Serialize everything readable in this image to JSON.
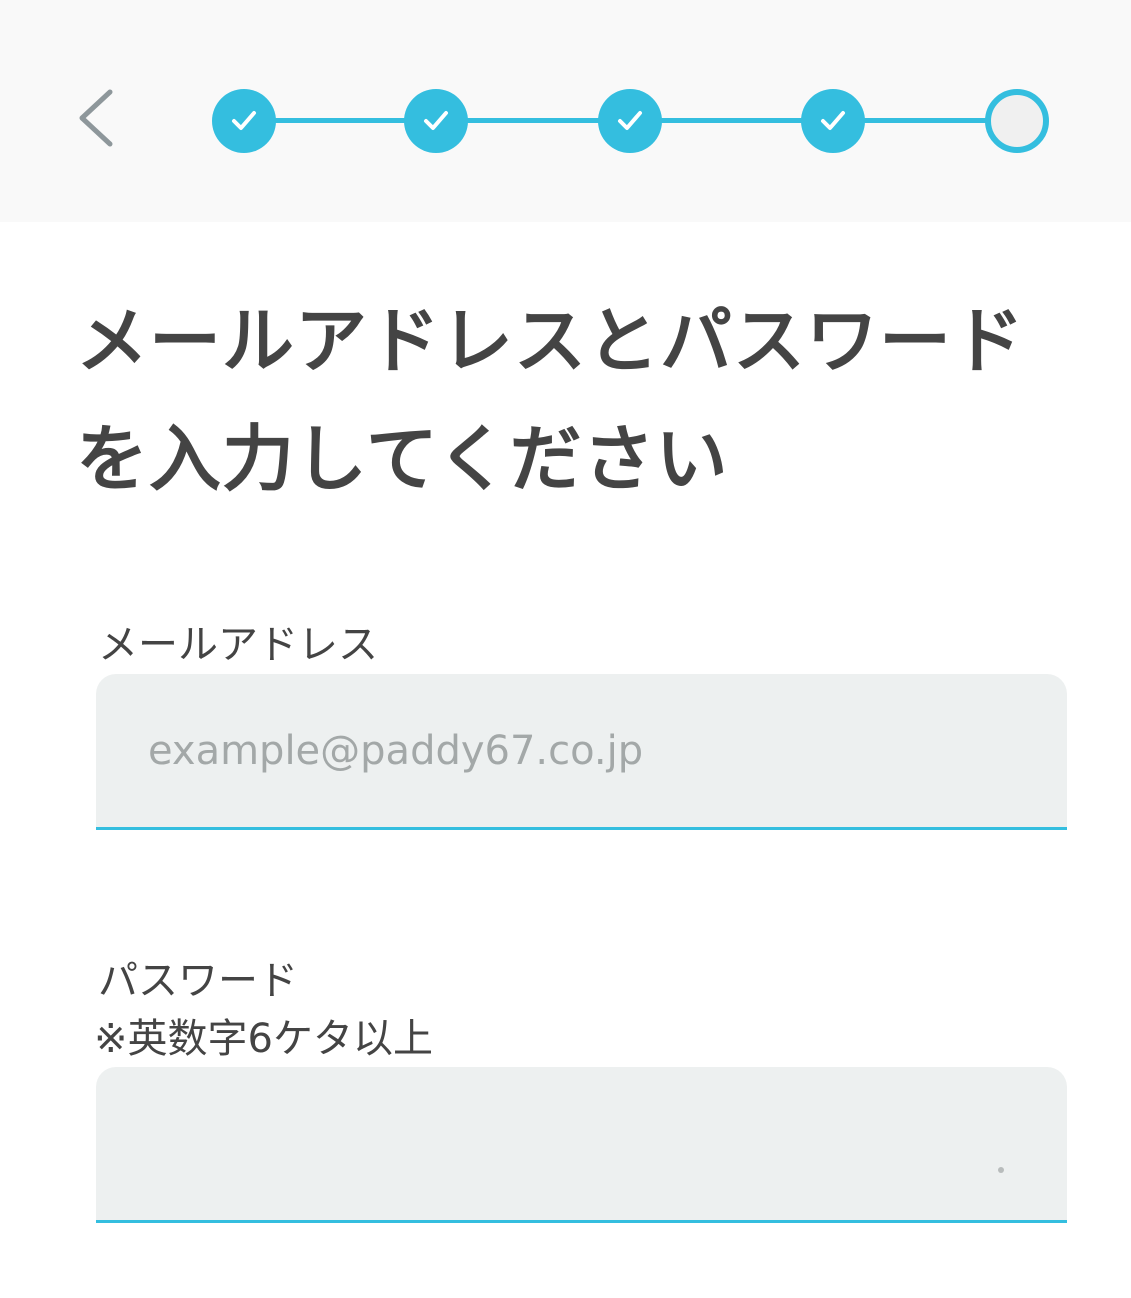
{
  "colors": {
    "accent": "#34bedf",
    "title_text": "#444444",
    "input_background": "#edf0f0",
    "header_background": "#f9f9f9"
  },
  "header": {
    "back_icon": "chevron-left-icon",
    "steps": [
      {
        "status": "done",
        "icon": "check-icon"
      },
      {
        "status": "done",
        "icon": "check-icon"
      },
      {
        "status": "done",
        "icon": "check-icon"
      },
      {
        "status": "done",
        "icon": "check-icon"
      },
      {
        "status": "current",
        "icon": ""
      }
    ]
  },
  "page": {
    "title_line1": "メールアドレスとパスワード",
    "title_line2": "を入力してください"
  },
  "form": {
    "email": {
      "label": "メールアドレス",
      "placeholder": "example@paddy67.co.jp",
      "value": ""
    },
    "password": {
      "label": "パスワード",
      "note": "※英数字6ケタ以上",
      "value": ""
    }
  }
}
